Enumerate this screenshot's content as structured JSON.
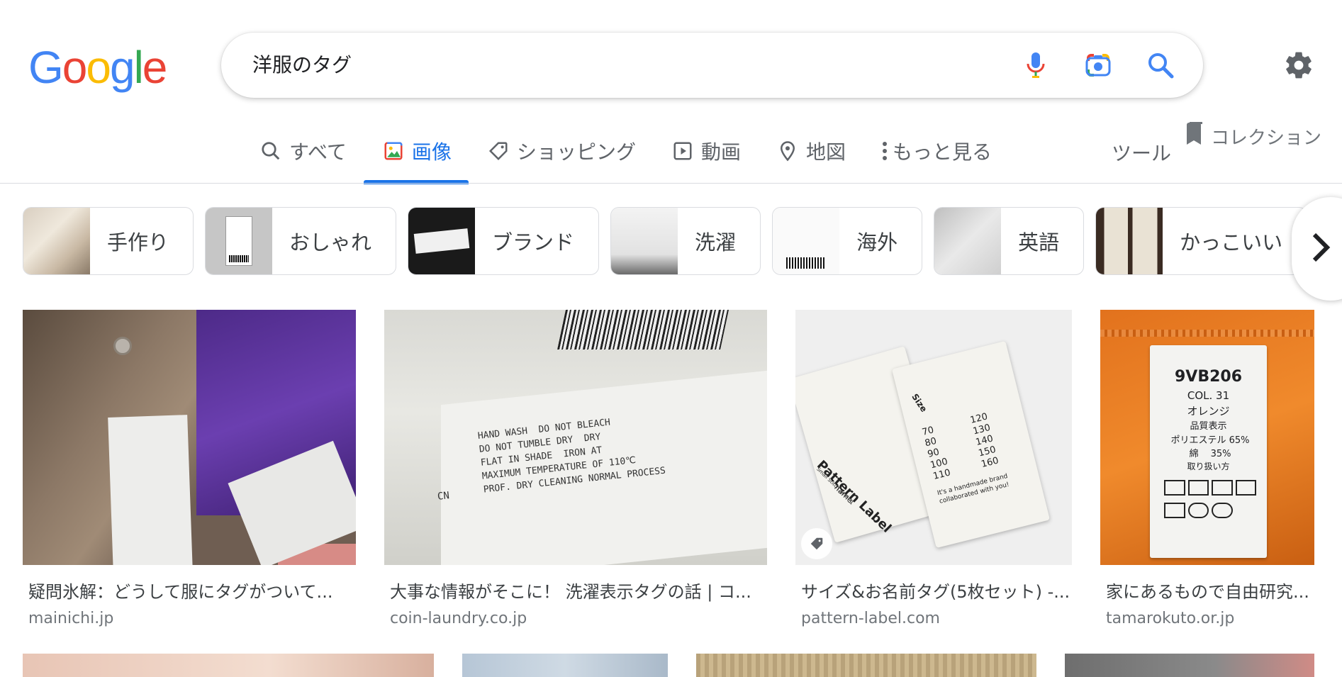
{
  "logo": "Google",
  "search": {
    "query": "洋服のタグ"
  },
  "tabs": [
    {
      "label": "すべて",
      "icon": "search-icon"
    },
    {
      "label": "画像",
      "icon": "image-icon",
      "active": true
    },
    {
      "label": "ショッピング",
      "icon": "tag-icon"
    },
    {
      "label": "動画",
      "icon": "play-icon"
    },
    {
      "label": "地図",
      "icon": "location-icon"
    },
    {
      "label": "もっと見る",
      "icon": "more-vert-icon"
    }
  ],
  "tools_label": "ツール",
  "collection_label": "コレクション",
  "chips": [
    {
      "label": "手作り"
    },
    {
      "label": "おしゃれ"
    },
    {
      "label": "ブランド"
    },
    {
      "label": "洗濯"
    },
    {
      "label": "海外"
    },
    {
      "label": "英語"
    },
    {
      "label": "かっこいい"
    }
  ],
  "results": [
    {
      "title": "疑問氷解：どうして服にタグがついて...",
      "source": "mainichi.jp"
    },
    {
      "title": "大事な情報がそこに！ 洗濯表示タグの話 | コ...",
      "source": "coin-laundry.co.jp"
    },
    {
      "title": "サイズ&お名前タグ(5枚セット) -...",
      "source": "pattern-label.com"
    },
    {
      "title": "家にあるもので自由研究...",
      "source": "tamarokuto.or.jp"
    }
  ],
  "image_text": {
    "barcode_label": "HAND WASH  DO NOT BLEACH\nDO NOT TUMBLE DRY  DRY\nFLAT IN SHADE  IRON AT\nMAXIMUM TEMPERATURE OF 110℃\nPROF. DRY CLEANING NORMAL PROCESS",
    "cn": "CN",
    "pattern_label_brand": "Pattern Label",
    "pattern_label_sub": "Small Stitch Sewing",
    "name_label": "name.",
    "size_label": "Size",
    "sizes_left": [
      "70",
      "80",
      "90",
      "100",
      "110"
    ],
    "sizes_right": [
      "120",
      "130",
      "140",
      "150",
      "160"
    ],
    "handmade_text": "It's a handmade brand collaborated with you!",
    "orange_code": "9VB206",
    "orange_col": "COL. 31",
    "orange_color": "オレンジ",
    "orange_quality": "品質表示",
    "orange_poly": "ポリエステル 65%",
    "orange_cotton": "綿　 35%",
    "orange_care": "取り扱い方"
  },
  "colors": {
    "accent": "#1a73e8",
    "blue": "#4285F4",
    "red": "#EA4335",
    "yellow": "#FBBC05",
    "green": "#34A853"
  }
}
